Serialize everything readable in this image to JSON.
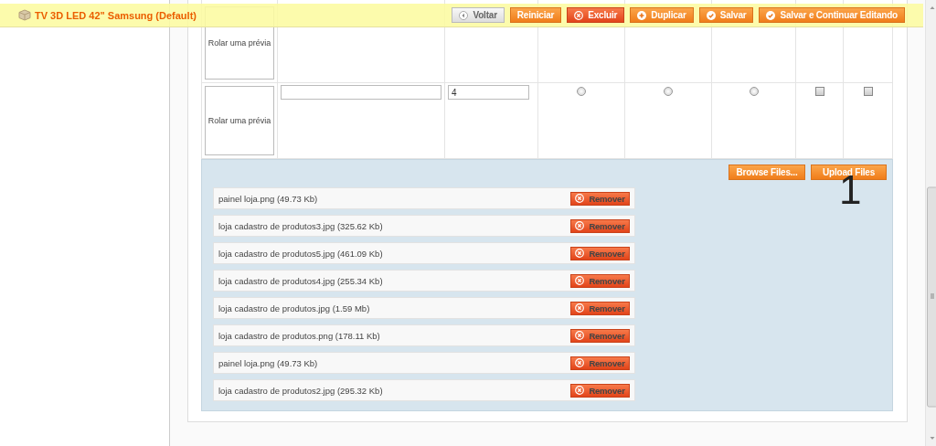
{
  "header": {
    "title": "TV 3D LED 42\" Samsung (Default)",
    "buttons": [
      {
        "label": "Voltar",
        "kind": "back"
      },
      {
        "label": "Reiniciar",
        "kind": "plain"
      },
      {
        "label": "Excluir",
        "kind": "delete"
      },
      {
        "label": "Duplicar",
        "kind": "add"
      },
      {
        "label": "Salvar",
        "kind": "save"
      },
      {
        "label": "Salvar e Continuar Editando",
        "kind": "save"
      }
    ]
  },
  "image_rows": [
    {
      "preview": "Rolar uma prévia"
    },
    {
      "preview": "Rolar uma prévia",
      "sort_order": "4",
      "radios": [
        {
          "selected": false
        },
        {
          "selected": false
        },
        {
          "selected": false
        }
      ],
      "checkboxes": [
        {
          "checked": false
        },
        {
          "checked": false
        }
      ]
    }
  ],
  "upload": {
    "buttons": [
      "Browse Files...",
      "Upload Files"
    ],
    "annotation": "1",
    "files": [
      {
        "name": "painel loja.png (49.73 Kb)",
        "action": "Remover"
      },
      {
        "name": "loja cadastro de produtos3.jpg (325.62 Kb)",
        "action": "Remover"
      },
      {
        "name": "loja cadastro de produtos5.jpg (461.09 Kb)",
        "action": "Remover"
      },
      {
        "name": "loja cadastro de produtos4.jpg (255.34 Kb)",
        "action": "Remover"
      },
      {
        "name": "loja cadastro de produtos.jpg (1.59 Mb)",
        "action": "Remover"
      },
      {
        "name": "loja cadastro de produtos.png (178.11 Kb)",
        "action": "Remover"
      },
      {
        "name": "painel loja.png (49.73 Kb)",
        "action": "Remover"
      },
      {
        "name": "loja cadastro de produtos2.jpg (295.32 Kb)",
        "action": "Remover"
      }
    ]
  }
}
